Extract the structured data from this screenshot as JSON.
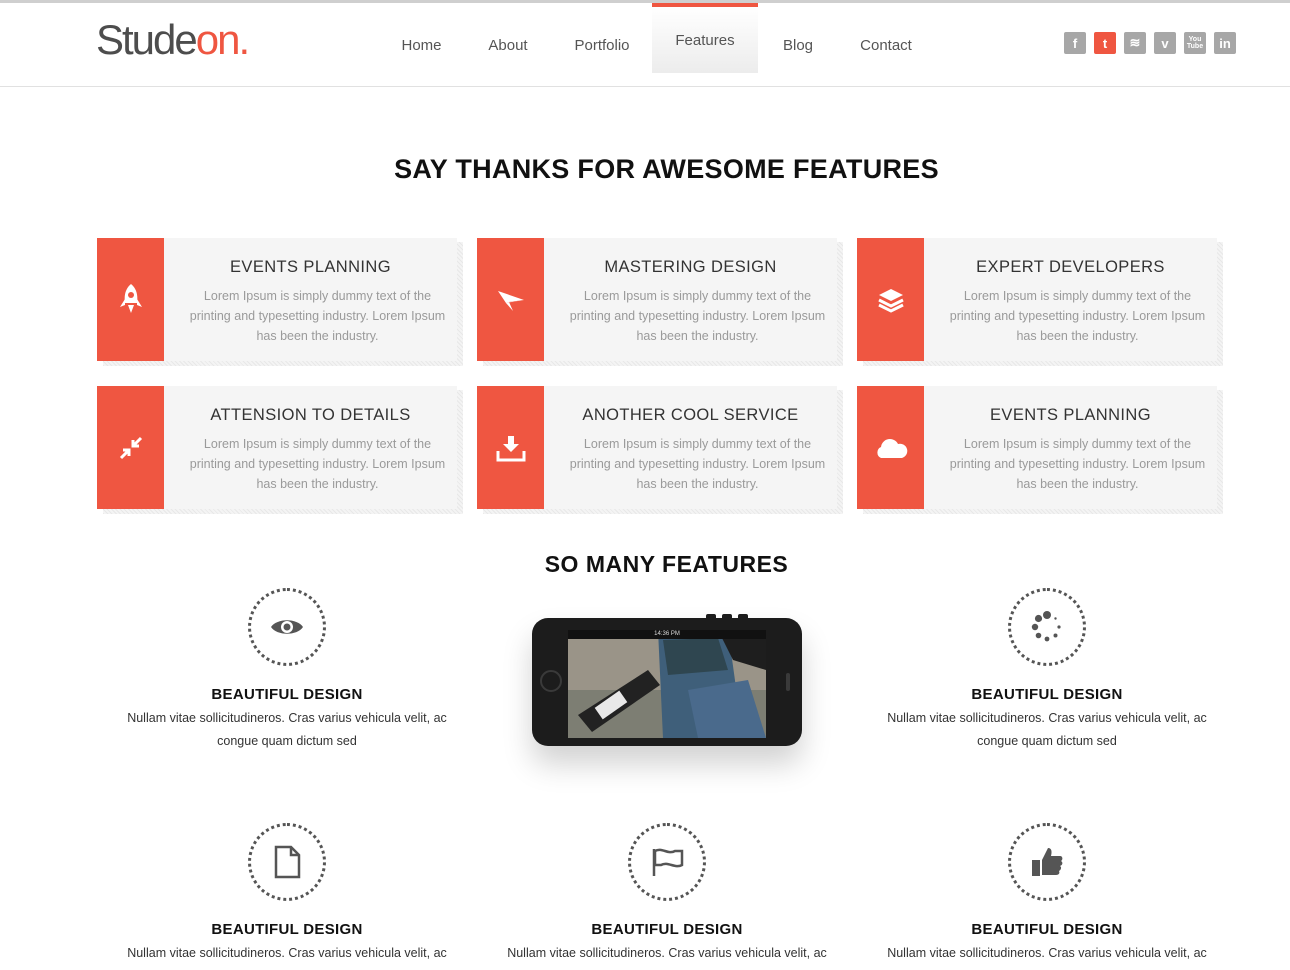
{
  "header": {
    "logo": {
      "main": "Stude",
      "accent": "on."
    },
    "nav": [
      {
        "label": "Home"
      },
      {
        "label": "About"
      },
      {
        "label": "Portfolio"
      },
      {
        "label": "Features",
        "active": true
      },
      {
        "label": "Blog"
      },
      {
        "label": "Contact"
      }
    ],
    "social": [
      {
        "icon": "facebook-icon",
        "glyph": "f"
      },
      {
        "icon": "twitter-icon",
        "glyph": "t"
      },
      {
        "icon": "rss-icon",
        "glyph": "≋"
      },
      {
        "icon": "vimeo-icon",
        "glyph": "v"
      },
      {
        "icon": "youtube-icon",
        "glyph": "You Tube"
      },
      {
        "icon": "linkedin-icon",
        "glyph": "in"
      }
    ]
  },
  "section1": {
    "title": "SAY THANKS FOR AWESOME FEATURES",
    "cards": [
      {
        "title": "EVENTS PLANNING",
        "text": "Lorem Ipsum is simply dummy text of the printing and typesetting industry. Lorem Ipsum has been the industry.",
        "icon": "rocket-icon"
      },
      {
        "title": "MASTERING DESIGN",
        "text": "Lorem Ipsum is simply dummy text of the printing and typesetting industry. Lorem Ipsum has been the industry.",
        "icon": "paper-plane-icon"
      },
      {
        "title": "EXPERT DEVELOPERS",
        "text": "Lorem Ipsum is simply dummy text of the printing and typesetting industry. Lorem Ipsum has been the industry.",
        "icon": "layers-icon"
      },
      {
        "title": "ATTENSION TO DETAILS",
        "text": "Lorem Ipsum is simply dummy text of the printing and typesetting industry. Lorem Ipsum has been the industry.",
        "icon": "compress-icon"
      },
      {
        "title": "ANOTHER COOL SERVICE",
        "text": "Lorem Ipsum is simply dummy text of the printing and typesetting industry. Lorem Ipsum has been the industry.",
        "icon": "download-icon"
      },
      {
        "title": "EVENTS PLANNING",
        "text": "Lorem Ipsum is simply dummy text of the printing and typesetting industry. Lorem Ipsum has been the industry.",
        "icon": "cloud-icon"
      }
    ]
  },
  "section2": {
    "title": "SO MANY FEATURES",
    "phone_status": "14:36 PM",
    "features": [
      {
        "title": "BEAUTIFUL DESIGN",
        "text": "Nullam vitae sollicitudineros. Cras varius vehicula velit, ac congue quam dictum sed",
        "icon": "eye-icon"
      },
      {
        "title": "BEAUTIFUL DESIGN",
        "text": "Nullam vitae sollicitudineros. Cras varius vehicula velit, ac congue quam dictum sed",
        "icon": "spinner-icon"
      },
      {
        "title": "BEAUTIFUL DESIGN",
        "text": "Nullam vitae sollicitudineros. Cras varius vehicula velit, ac congue",
        "icon": "file-icon"
      },
      {
        "title": "BEAUTIFUL DESIGN",
        "text": "Nullam vitae sollicitudineros. Cras varius vehicula velit, ac congue",
        "icon": "flag-icon"
      },
      {
        "title": "BEAUTIFUL DESIGN",
        "text": "Nullam vitae sollicitudineros. Cras varius vehicula velit, ac congue",
        "icon": "thumbs-up-icon"
      }
    ]
  },
  "colors": {
    "accent": "#ef5641",
    "card_bg": "#f5f5f5",
    "social_grey": "#a7a7a7"
  }
}
